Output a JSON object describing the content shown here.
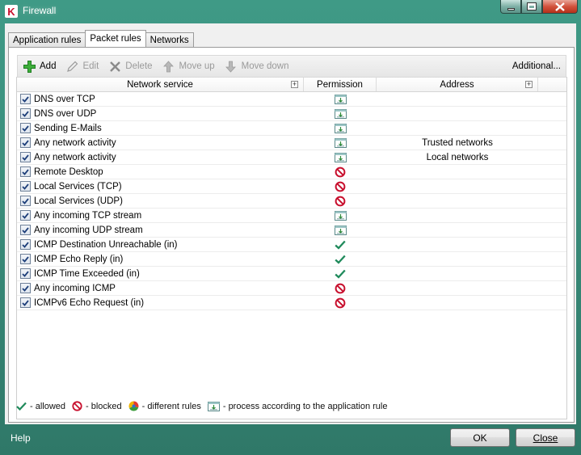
{
  "window": {
    "title": "Firewall",
    "logo_letter": "K"
  },
  "tabs": [
    {
      "label": "Application rules",
      "active": false
    },
    {
      "label": "Packet rules",
      "active": true
    },
    {
      "label": "Networks",
      "active": false
    }
  ],
  "toolbar": {
    "add": "Add",
    "edit": "Edit",
    "delete": "Delete",
    "move_up": "Move up",
    "move_down": "Move down",
    "additional": "Additional..."
  },
  "grid": {
    "columns": {
      "service": "Network service",
      "permission": "Permission",
      "address": "Address"
    },
    "rows": [
      {
        "service": "DNS over TCP",
        "permission": "app-rule",
        "address": ""
      },
      {
        "service": "DNS over UDP",
        "permission": "app-rule",
        "address": ""
      },
      {
        "service": "Sending E-Mails",
        "permission": "app-rule",
        "address": ""
      },
      {
        "service": "Any network activity",
        "permission": "app-rule",
        "address": "Trusted networks"
      },
      {
        "service": "Any network activity",
        "permission": "app-rule",
        "address": "Local networks"
      },
      {
        "service": "Remote Desktop",
        "permission": "blocked",
        "address": ""
      },
      {
        "service": "Local Services (TCP)",
        "permission": "blocked",
        "address": ""
      },
      {
        "service": "Local Services (UDP)",
        "permission": "blocked",
        "address": ""
      },
      {
        "service": "Any incoming TCP stream",
        "permission": "app-rule",
        "address": ""
      },
      {
        "service": "Any incoming UDP stream",
        "permission": "app-rule",
        "address": ""
      },
      {
        "service": "ICMP Destination Unreachable (in)",
        "permission": "allowed",
        "address": ""
      },
      {
        "service": "ICMP Echo Reply (in)",
        "permission": "allowed",
        "address": ""
      },
      {
        "service": "ICMP Time Exceeded (in)",
        "permission": "allowed",
        "address": ""
      },
      {
        "service": "Any incoming ICMP",
        "permission": "blocked",
        "address": ""
      },
      {
        "service": "ICMPv6 Echo Request (in)",
        "permission": "blocked",
        "address": ""
      }
    ]
  },
  "legend": {
    "allowed": "- allowed",
    "blocked": "- blocked",
    "different": "- different rules",
    "app_rule": "- process according to the application rule"
  },
  "footer": {
    "help": "Help",
    "ok": "OK",
    "close": "Close"
  },
  "colors": {
    "allowed": "#1f8a5b",
    "blocked": "#c8102e",
    "frame": "#3f9a86"
  }
}
